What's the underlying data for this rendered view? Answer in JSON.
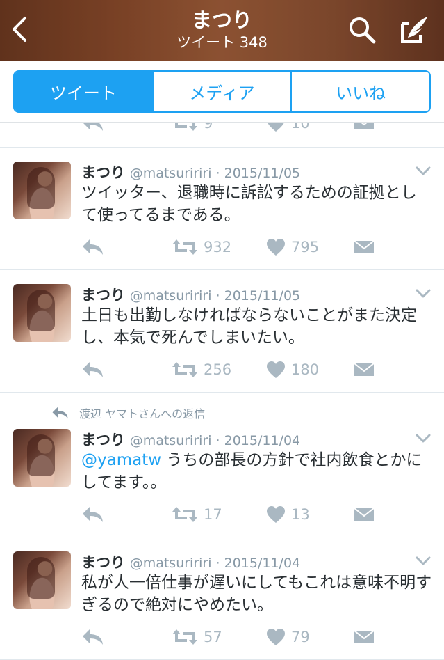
{
  "header": {
    "title": "まつり",
    "subtitle": "ツイート 348",
    "back_icon": "chevron-left-icon",
    "search_icon": "search-icon",
    "compose_icon": "compose-tweet-icon"
  },
  "tabs": [
    {
      "label": "ツイート",
      "active": true
    },
    {
      "label": "メディア",
      "active": false
    },
    {
      "label": "いいね",
      "active": false
    }
  ],
  "partial_tweet": {
    "retweets": "9",
    "likes": "10"
  },
  "tweets": [
    {
      "name": "まつり",
      "handle_date": "@matsuririri · 2015/11/05",
      "reply_context": "",
      "mention": "",
      "text": "ツイッター、退職時に訴訟するための証拠として使ってるまである。",
      "retweets": "932",
      "likes": "795"
    },
    {
      "name": "まつり",
      "handle_date": "@matsuririri · 2015/11/05",
      "reply_context": "",
      "mention": "",
      "text": "土日も出勤しなければならないことがまた決定し、本気で死んでしまいたい。",
      "retweets": "256",
      "likes": "180"
    },
    {
      "name": "まつり",
      "handle_date": "@matsuririri · 2015/11/04",
      "reply_context": "渡辺 ヤマトさんへの返信",
      "mention": "@yamatw",
      "text": " うちの部長の方針で社内飲食とかにしてます。。",
      "retweets": "17",
      "likes": "13"
    },
    {
      "name": "まつり",
      "handle_date": "@matsuririri · 2015/11/04",
      "reply_context": "",
      "mention": "",
      "text": "私が人一倍仕事が遅いにしてもこれは意味不明すぎるので絶対にやめたい。",
      "retweets": "57",
      "likes": "79"
    }
  ],
  "colors": {
    "accent": "#1da1f2",
    "action_gray": "#aab8c2",
    "text": "#292f33",
    "secondary": "#8899a6"
  }
}
